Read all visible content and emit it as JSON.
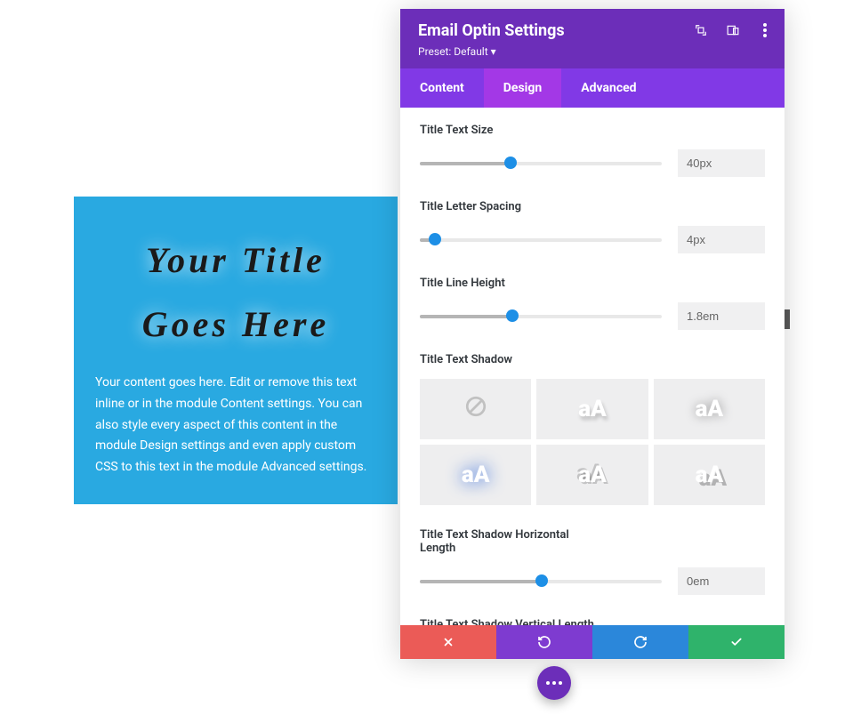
{
  "preview": {
    "title_line1": "Your Title",
    "title_line2": "Goes Here",
    "content": "Your content goes here. Edit or remove this text inline or in the module Content settings. You can also style every aspect of this content in the module Design settings and even apply custom CSS to this text in the module Advanced settings."
  },
  "panel": {
    "title": "Email Optin Settings",
    "preset_label": "Preset: Default",
    "tabs": {
      "content": "Content",
      "design": "Design",
      "advanced": "Advanced",
      "active": "design"
    }
  },
  "fields": {
    "text_size": {
      "label": "Title Text Size",
      "value": "40px",
      "fill": 37
    },
    "letter_spacing": {
      "label": "Title Letter Spacing",
      "value": "4px",
      "fill": 6
    },
    "line_height": {
      "label": "Title Line Height",
      "value": "1.8em",
      "fill": 38
    },
    "text_shadow": {
      "label": "Title Text Shadow"
    },
    "shadow_h": {
      "label": "Title Text Shadow Horizontal Length",
      "value": "0em",
      "fill": 50
    },
    "shadow_v": {
      "label": "Title Text Shadow Vertical Length"
    }
  },
  "shadow_presets": {
    "sample": "aA",
    "none_glyph": "⃠"
  }
}
